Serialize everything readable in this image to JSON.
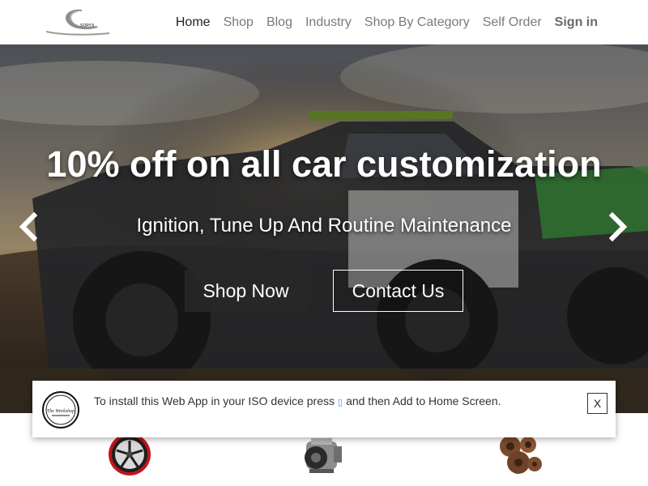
{
  "nav": {
    "logo_text": "SORYX",
    "items": [
      {
        "label": "Home",
        "active": true
      },
      {
        "label": "Shop"
      },
      {
        "label": "Blog"
      },
      {
        "label": "Industry"
      },
      {
        "label": "Shop By Category"
      },
      {
        "label": "Self Order"
      }
    ],
    "signin_label": "Sign in"
  },
  "hero": {
    "headline": "10% off on all car customization",
    "subline": "Ignition, Tune Up And Routine Maintenance",
    "shop_button": "Shop Now",
    "contact_button": "Contact Us",
    "prev_icon": "chevron-left-icon",
    "next_icon": "chevron-right-icon"
  },
  "install_banner": {
    "text_before": "To install this Web App in your ISO device press",
    "text_after": "and then Add to Home Screen.",
    "share_icon": "share-icon",
    "close_label": "X",
    "logo_text": "The Workshop"
  },
  "colors": {
    "nav_active": "#222222",
    "nav_inactive": "#7a7a7a",
    "button_dark": "#282828",
    "share_icon": "#4a90e2"
  }
}
